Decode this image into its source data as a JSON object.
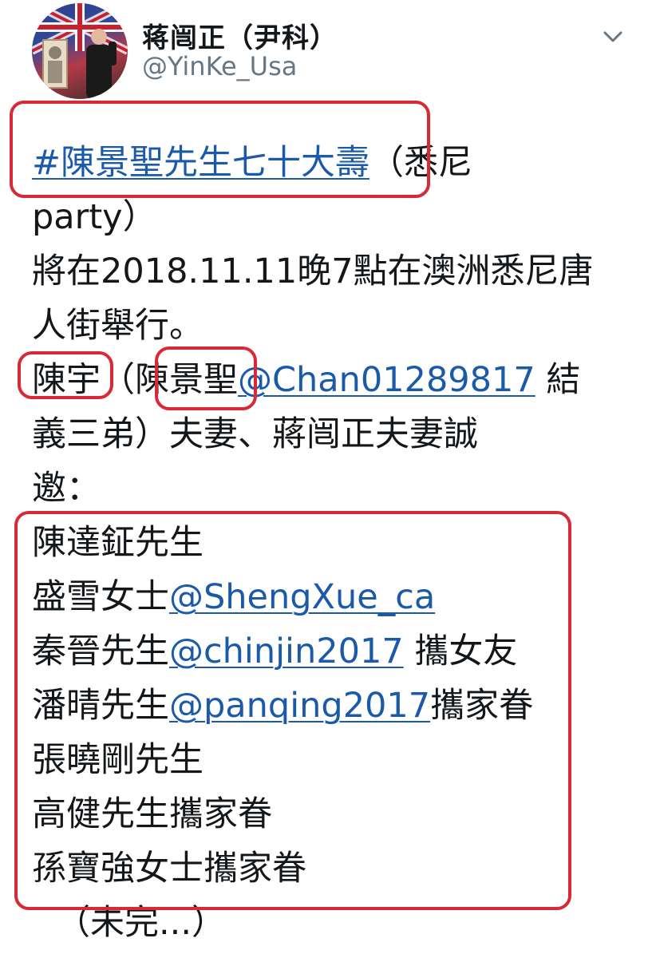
{
  "user": {
    "display_name": "蒋闿正（尹科）",
    "handle": "@YinKe_Usa",
    "avatar_icon": "profile-photo",
    "menu_icon": "chevron-down-icon"
  },
  "tweet": {
    "hashtag": "#陳景聖先生七十大壽",
    "line1_tail": "（悉尼",
    "line2": "party）",
    "line3": "將在2018.11.11晚7點在澳洲悉尼唐",
    "line4": "人街舉行。",
    "line5_a": "陳宇",
    "line5_b": "（陳景聖",
    "line5_mention": "@Chan01289817",
    "line5_c": " 結",
    "line6": "義三弟）夫妻、蔣闿正夫妻誠",
    "line7": "邀：",
    "guests": [
      {
        "name": "陳達鉦先生"
      },
      {
        "name": "盛雪女士",
        "mention": "@ShengXue_ca"
      },
      {
        "name": "秦晉先生",
        "mention": "@chinjin2017",
        "suffix": " 攜女友"
      },
      {
        "name": "潘晴先生",
        "mention": "@panqing2017",
        "suffix": "攜家眷"
      },
      {
        "name": "張曉剛先生"
      },
      {
        "name": "高健先生攜家眷"
      },
      {
        "name": "孫寶強女士攜家眷"
      }
    ],
    "ending": "（未完...）"
  },
  "colors": {
    "link": "#1b5aa8",
    "highlight": "#d82a36",
    "text": "#14171a",
    "secondary": "#657786"
  }
}
